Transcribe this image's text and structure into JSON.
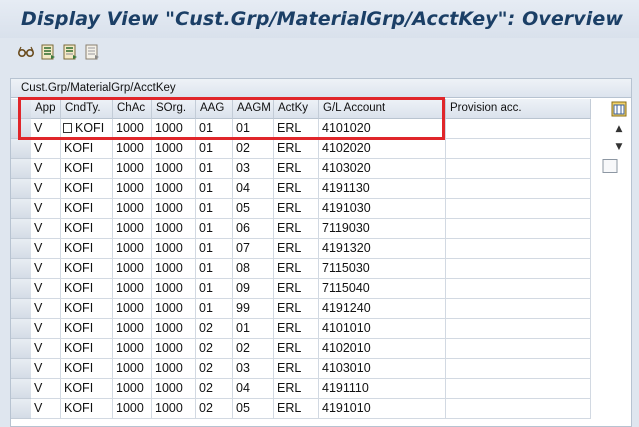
{
  "window": {
    "title": "Display View \"Cust.Grp/MaterialGrp/AcctKey\": Overview"
  },
  "toolbar": {
    "icons": [
      "glasses-icon",
      "select-all-icon",
      "select-block-icon",
      "deselect-all-icon"
    ]
  },
  "table": {
    "title": "Cust.Grp/MaterialGrp/AcctKey",
    "columns": [
      "App",
      "CndTy.",
      "ChAc",
      "SOrg.",
      "AAG",
      "AAGM",
      "ActKy",
      "G/L Account",
      "Provision acc."
    ],
    "rows": [
      [
        "V",
        "KOFI",
        "1000",
        "1000",
        "01",
        "01",
        "ERL",
        "4101020",
        ""
      ],
      [
        "V",
        "KOFI",
        "1000",
        "1000",
        "01",
        "02",
        "ERL",
        "4102020",
        ""
      ],
      [
        "V",
        "KOFI",
        "1000",
        "1000",
        "01",
        "03",
        "ERL",
        "4103020",
        ""
      ],
      [
        "V",
        "KOFI",
        "1000",
        "1000",
        "01",
        "04",
        "ERL",
        "4191130",
        ""
      ],
      [
        "V",
        "KOFI",
        "1000",
        "1000",
        "01",
        "05",
        "ERL",
        "4191030",
        ""
      ],
      [
        "V",
        "KOFI",
        "1000",
        "1000",
        "01",
        "06",
        "ERL",
        "7119030",
        ""
      ],
      [
        "V",
        "KOFI",
        "1000",
        "1000",
        "01",
        "07",
        "ERL",
        "4191320",
        ""
      ],
      [
        "V",
        "KOFI",
        "1000",
        "1000",
        "01",
        "08",
        "ERL",
        "7115030",
        ""
      ],
      [
        "V",
        "KOFI",
        "1000",
        "1000",
        "01",
        "09",
        "ERL",
        "7115040",
        ""
      ],
      [
        "V",
        "KOFI",
        "1000",
        "1000",
        "01",
        "99",
        "ERL",
        "4191240",
        ""
      ],
      [
        "V",
        "KOFI",
        "1000",
        "1000",
        "02",
        "01",
        "ERL",
        "4101010",
        ""
      ],
      [
        "V",
        "KOFI",
        "1000",
        "1000",
        "02",
        "02",
        "ERL",
        "4102010",
        ""
      ],
      [
        "V",
        "KOFI",
        "1000",
        "1000",
        "02",
        "03",
        "ERL",
        "4103010",
        ""
      ],
      [
        "V",
        "KOFI",
        "1000",
        "1000",
        "02",
        "04",
        "ERL",
        "4191110",
        ""
      ],
      [
        "V",
        "KOFI",
        "1000",
        "1000",
        "02",
        "05",
        "ERL",
        "4191010",
        ""
      ]
    ]
  },
  "colors": {
    "highlight": "#e0262a",
    "title": "#1b3f66"
  }
}
